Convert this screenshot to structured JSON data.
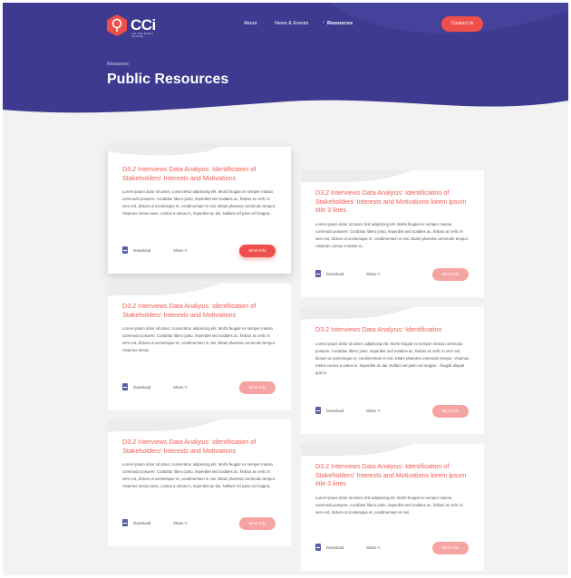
{
  "header": {
    "logo_text": "CCi",
    "logo_tagline": "LET THIS EARTH CHANGE",
    "nav": [
      {
        "label": "About",
        "active": false
      },
      {
        "label": "News & Events",
        "active": false
      },
      {
        "label": "Resources",
        "active": true
      }
    ],
    "contact_label": "Contact Us"
  },
  "hero": {
    "breadcrumb": "Resources",
    "title": "Public Resources"
  },
  "colors": {
    "hero_bg": "#3d3a8f",
    "accent": "#ef4f4a",
    "accent_light": "#f5a4a1",
    "card_title": "#f15d53"
  },
  "cards": [
    {
      "title": "D3.2 Interviews Data Analysis: Identification of Stakeholders' Interests and Motivations",
      "text": "Lorem ipsum dolor sit amet, consectetur adipiscing elit. Morbi feugiat ex semper massa commodo posuere. Curabitur libero justo, imperdiet sed sodales ac, finibus ac velit. In sem est, dictum ut scelerisque et, condimentum in nisi. Etiam pharetra commodo tempor. Vivamus metus sene, cursus a varius in, imperdiet ac dui. Nullam vel justo vel magna...",
      "download": "Download",
      "share": "Share",
      "more": "More Info"
    },
    {
      "title": "D3.2 Interviews Data Analysis: Identification of Stakeholders' Interests and Motivations",
      "text": "Lorem ipsum dolor sit amet, consectetur adipiscing elit. Morbi feugiat ex semper massa commodo posuere. Curabitur libero justo, imperdiet sed sodales ac, finibus ac velit. In sem est, dictum ut scelerisque et, condimentum in nisi. Etiam pharetra commodo tempor. Vivamus metus",
      "download": "Download",
      "share": "Share",
      "more": "More Info"
    },
    {
      "title": "D3.2 Interviews Data Analysis: Identification of Stakeholders' Interests and Motivations",
      "text": "Lorem ipsum dolor sit amet, consectetur adipiscing elit. Morbi feugiat ex semper massa commodo posuere. Curabitur libero justo, imperdiet sed sodales ac, finibus ac velit. In sem est, dictum ut scelerisque et, condimentum in nisi. Etiam pharetra commodo tempor. Vivamus metus sene, cursus a varius in, imperdiet ac dui. Nullam vel justo vel magna...",
      "download": "Download",
      "share": "Share",
      "more": "More Info"
    },
    {
      "title": "D3.2 Interviews Data Analysis: Identification of Stakeholders' Interests and Motivations lorem ipsum title 3 lines",
      "text": "Lorem ipsum dolor sit amet, link adipiscing elit. Morbi feugiat ex semper massa commodo posuere. Curabitur libero justo, imperdiet sed sodales ac, finibus ac velit. In sem est, dictum ut scelerisque et, condimentum in nisi. Etiam pharetra commodo tempor. Vivamus cursus a varius in...",
      "download": "Download",
      "share": "Share",
      "more": "More Info"
    },
    {
      "title": "D3.2 Interviews Data Analysis: Identification",
      "text": "Lorem ipsum dolor sit amet, adipiscing elit. Morbi feugiat ex semper massa commodo posuere. Curabitur libero justo, imperdiet sed sodales ac, finibus ac velit. In sem est, dictum ut scelerisque et, condimentum in nisi. Etiam pharetra commodo tempor. Vivamus metus cursus a varius in, imperdiet ac dui. Nullam vel justo vel magna... feugiat aliquet quis in",
      "download": "Download",
      "share": "Share",
      "more": "More Info"
    },
    {
      "title": "D3.2 Interviews Data Analysis: Identification of Stakeholders' Interests and Motivations lorem ipsum title 3 lines",
      "text": "Lorem ipsum dolor sit amet, link adipiscing elit. Morbi feugiat ex semper massa commodo posuere. Curabitur libero justo, imperdiet sed sodales ac, finibus ac velit. In sem est, dictum ut scelerisque et, condimentum in nisi.",
      "download": "Download",
      "share": "Share",
      "more": "More Info"
    }
  ]
}
